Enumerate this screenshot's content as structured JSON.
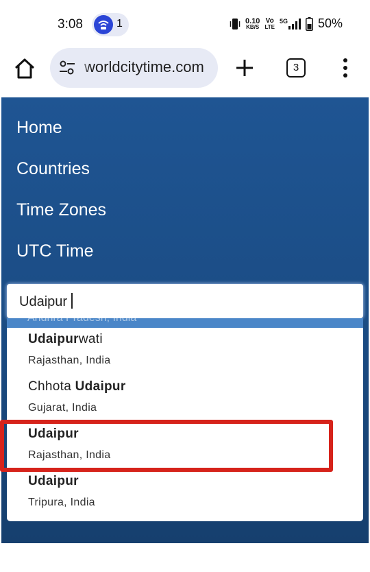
{
  "status_bar": {
    "time": "3:08",
    "hotspot_count": "1",
    "network_speed_value": "0.10",
    "network_speed_unit": "KB/S",
    "volte_top": "Vo",
    "volte_bottom": "LTE",
    "network_type": "5G",
    "battery": "50%"
  },
  "browser": {
    "url": "worldcitytime.com",
    "tab_count": "3"
  },
  "nav": {
    "items": [
      "Home",
      "Countries",
      "Time Zones",
      "UTC Time"
    ]
  },
  "search": {
    "value": "Udaipur"
  },
  "dropdown": {
    "ghost_text": "Andhra Pradesh, India",
    "items": [
      {
        "prefix": "",
        "match": "Udaipur",
        "suffix": "wati",
        "region": "Rajasthan, India"
      },
      {
        "prefix": "Chhota ",
        "match": "Udaipur",
        "suffix": "",
        "region": "Gujarat, India"
      },
      {
        "prefix": "",
        "match": "Udaipur",
        "suffix": "",
        "region": "Rajasthan, India"
      },
      {
        "prefix": "",
        "match": "Udaipur",
        "suffix": "",
        "region": "Tripura, India"
      }
    ]
  },
  "colors": {
    "nav_bg": "#1b4d86",
    "highlight": "#d6231b",
    "hotspot": "#2b45d6"
  },
  "icons": [
    "hotspot-icon",
    "vibrate-icon",
    "signal-icon",
    "battery-icon",
    "home-icon",
    "site-settings-icon",
    "plus-icon",
    "more-vert-icon"
  ]
}
